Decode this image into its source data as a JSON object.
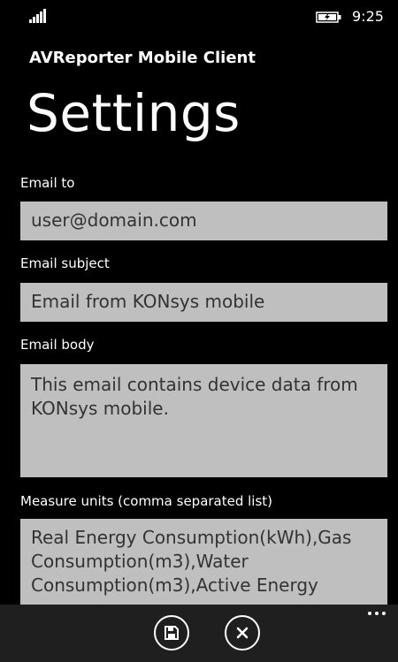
{
  "status_bar": {
    "time": "9:25",
    "signal_icon": "signal-bars-icon",
    "battery_icon": "battery-charging-icon"
  },
  "header": {
    "app_title": "AVReporter Mobile Client",
    "page_title": "Settings"
  },
  "form": {
    "email_to": {
      "label": "Email to",
      "value": "user@domain.com"
    },
    "email_subject": {
      "label": "Email subject",
      "value": "Email from KONsys mobile"
    },
    "email_body": {
      "label": "Email body",
      "value": "This email contains device data from KONsys mobile."
    },
    "measure_units": {
      "label": "Measure units (comma separated list)",
      "value": "Real Energy Consumption(kWh),Gas Consumption(m3),Water Consumption(m3),Active Energy"
    }
  },
  "app_bar": {
    "buttons": [
      {
        "icon": "floppy-disk-icon"
      },
      {
        "icon": "close-icon"
      }
    ],
    "more_icon": "ellipsis-icon"
  },
  "colors": {
    "background": "#000000",
    "field_background": "#bfbfbf",
    "field_text": "#333333",
    "app_bar": "#1f1f1f",
    "text": "#ffffff"
  }
}
